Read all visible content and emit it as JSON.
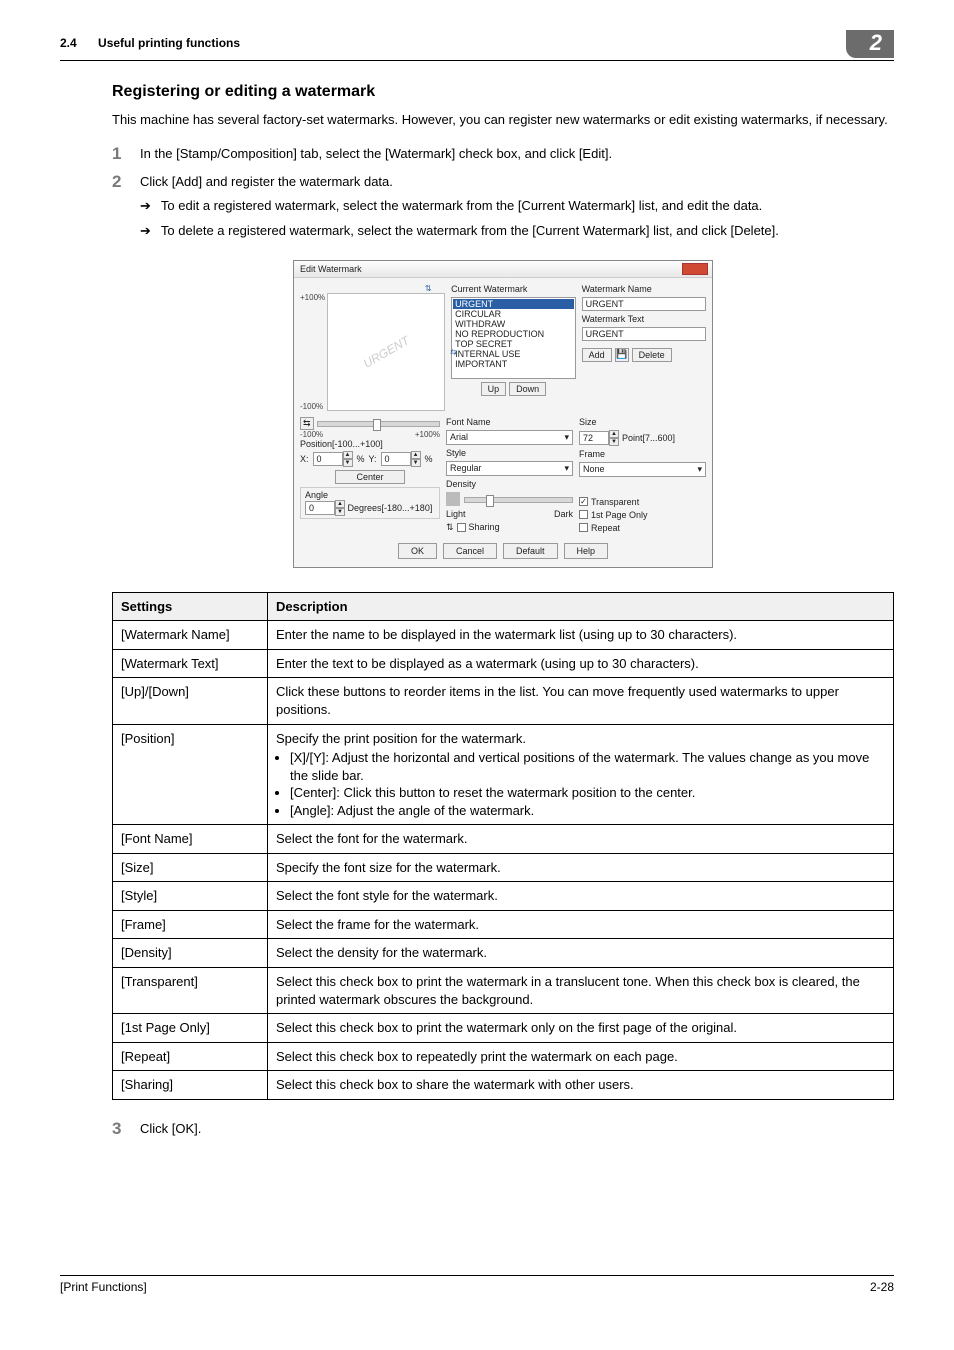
{
  "header": {
    "section_number": "2.4",
    "section_title": "Useful printing functions",
    "chapter_number": "2"
  },
  "subhead": "Registering or editing a watermark",
  "intro": "This machine has several factory-set watermarks. However, you can register new watermarks or edit existing watermarks, if necessary.",
  "steps": {
    "s1": {
      "num": "1",
      "text": "In the [Stamp/Composition] tab, select the [Watermark] check box, and click [Edit]."
    },
    "s2": {
      "num": "2",
      "text": "Click [Add] and register the watermark data.",
      "b1": "To edit a registered watermark, select the watermark from the [Current Watermark] list, and edit the data.",
      "b2": "To delete a registered watermark, select the watermark from the [Current Watermark] list, and click [Delete]."
    },
    "s3": {
      "num": "3",
      "text": "Click [OK]."
    }
  },
  "dialog": {
    "title": "Edit Watermark",
    "preview_text": "URGENT",
    "scale_plus": "+100%",
    "scale_minus": "-100%",
    "scale_minus_b": "-100%",
    "scale_plus_b": "+100%",
    "current_label": "Current Watermark",
    "list": {
      "i0": "URGENT",
      "i1": "CIRCULAR",
      "i2": "WITHDRAW",
      "i3": "NO REPRODUCTION",
      "i4": "TOP SECRET",
      "i5": "INTERNAL USE",
      "i6": "IMPORTANT"
    },
    "btn_up": "Up",
    "btn_down": "Down",
    "name_label": "Watermark Name",
    "name_value": "URGENT",
    "text_label": "Watermark Text",
    "text_value": "URGENT",
    "btn_add": "Add",
    "btn_delete": "Delete",
    "font_label": "Font Name",
    "font_value": "Arial",
    "size_label": "Size",
    "size_value": "72",
    "size_range": "Point[7...600]",
    "style_label": "Style",
    "style_value": "Regular",
    "frame_label": "Frame",
    "frame_value": "None",
    "position_label": "Position[-100...+100]",
    "x_label": "X:",
    "x_value": "0",
    "y_label": "Y:",
    "y_value": "0",
    "pct_a": "%",
    "pct_b": "%",
    "center_btn": "Center",
    "angle_label": "Angle",
    "angle_value": "0",
    "angle_unit": "Degrees[-180...+180]",
    "density_label": "Density",
    "density_light": "Light",
    "density_dark": "Dark",
    "sharing": "Sharing",
    "transparent": "Transparent",
    "first_page": "1st Page Only",
    "repeat": "Repeat",
    "ok": "OK",
    "cancel": "Cancel",
    "default": "Default",
    "help": "Help"
  },
  "table": {
    "h_settings": "Settings",
    "h_desc": "Description",
    "rows": {
      "r0": {
        "s": "[Watermark Name]",
        "d": "Enter the name to be displayed in the watermark list (using up to 30 characters)."
      },
      "r1": {
        "s": "[Watermark Text]",
        "d": "Enter the text to be displayed as a watermark (using up to 30 characters)."
      },
      "r2": {
        "s": "[Up]/[Down]",
        "d": "Click these buttons to reorder items in the list. You can move frequently used watermarks to upper positions."
      },
      "r3": {
        "s": "[Position]",
        "d": "Specify the print position for the watermark.",
        "b1": "[X]/[Y]: Adjust the horizontal and vertical positions of the watermark. The values change as you move the slide bar.",
        "b2": "[Center]: Click this button to reset the watermark position to the center.",
        "b3": "[Angle]: Adjust the angle of the watermark."
      },
      "r4": {
        "s": "[Font Name]",
        "d": "Select the font for the watermark."
      },
      "r5": {
        "s": "[Size]",
        "d": "Specify the font size for the watermark."
      },
      "r6": {
        "s": "[Style]",
        "d": "Select the font style for the watermark."
      },
      "r7": {
        "s": "[Frame]",
        "d": "Select the frame for the watermark."
      },
      "r8": {
        "s": "[Density]",
        "d": "Select the density for the watermark."
      },
      "r9": {
        "s": "[Transparent]",
        "d": "Select this check box to print the watermark in a translucent tone. When this check box is cleared, the printed watermark obscures the background."
      },
      "r10": {
        "s": "[1st Page Only]",
        "d": "Select this check box to print the watermark only on the first page of the original."
      },
      "r11": {
        "s": "[Repeat]",
        "d": "Select this check box to repeatedly print the watermark on each page."
      },
      "r12": {
        "s": "[Sharing]",
        "d": "Select this check box to share the watermark with other users."
      }
    }
  },
  "footer": {
    "left": "[Print Functions]",
    "right": "2-28"
  }
}
